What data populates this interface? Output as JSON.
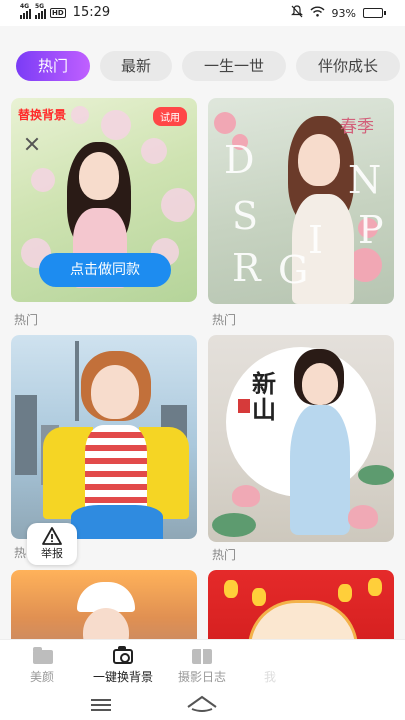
{
  "status_bar": {
    "net_1": "4G",
    "net_2": "5G",
    "hd": "HD",
    "time": "15:29",
    "battery_text": "93%",
    "battery_level": 0.93
  },
  "tabs": [
    {
      "label": "热门",
      "active": true
    },
    {
      "label": "最新",
      "active": false
    },
    {
      "label": "一生一世",
      "active": false
    },
    {
      "label": "伴你成长",
      "active": false
    }
  ],
  "cards": [
    {
      "tag": "替换背景",
      "badge": "试用",
      "cta": "点击做同款",
      "caption": "热门"
    },
    {
      "caption": "热门",
      "letters": [
        "D",
        "N",
        "S",
        "P",
        "R",
        "I",
        "G"
      ],
      "stamp": "春季"
    },
    {
      "caption": "热",
      "report_label": "举报"
    },
    {
      "caption": "热门",
      "title": "新\n山"
    },
    {},
    {}
  ],
  "bottom_nav": [
    {
      "label": "美颜",
      "icon": "folder-icon",
      "active": false
    },
    {
      "label": "一键换背景",
      "icon": "camera-icon",
      "active": true
    },
    {
      "label": "摄影日志",
      "icon": "book-icon",
      "active": false
    },
    {
      "label": "我",
      "icon": "user-icon",
      "active": false
    }
  ],
  "colors": {
    "accent_gradient_start": "#7b3cf6",
    "accent_gradient_end": "#c060ff",
    "cta_blue": "#1d8cf0",
    "tag_red": "#ff2b2b"
  }
}
